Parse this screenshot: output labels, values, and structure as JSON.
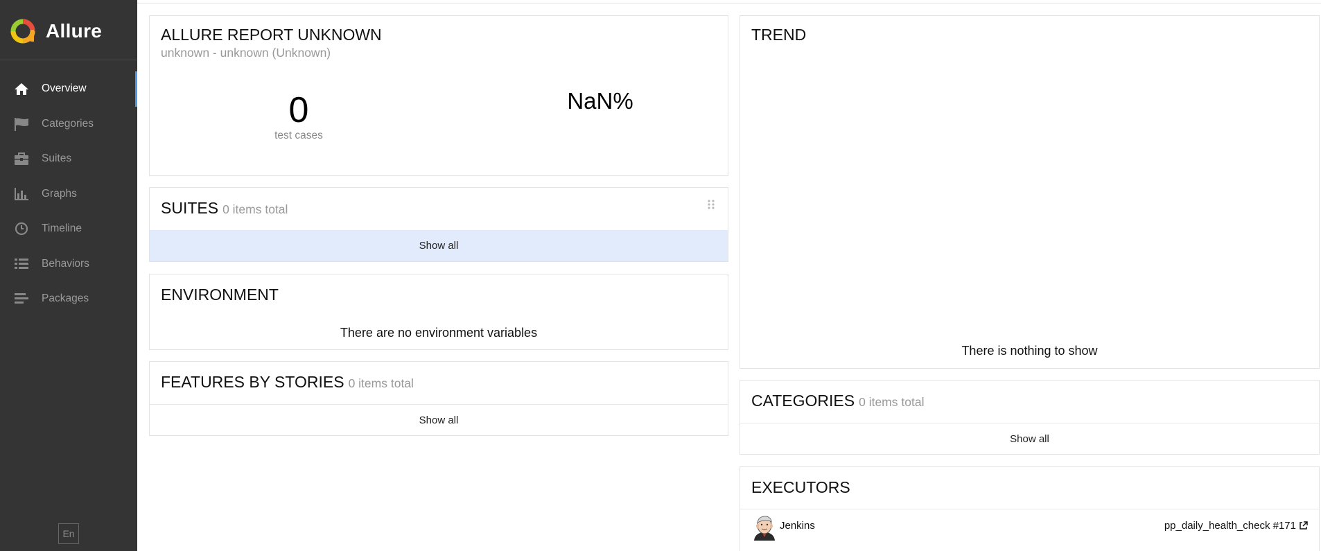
{
  "brand": {
    "name": "Allure"
  },
  "sidebar": {
    "items": [
      {
        "label": "Overview",
        "icon": "home-icon",
        "active": true
      },
      {
        "label": "Categories",
        "icon": "flag-icon",
        "active": false
      },
      {
        "label": "Suites",
        "icon": "briefcase-icon",
        "active": false
      },
      {
        "label": "Graphs",
        "icon": "bar-chart-icon",
        "active": false
      },
      {
        "label": "Timeline",
        "icon": "clock-icon",
        "active": false
      },
      {
        "label": "Behaviors",
        "icon": "list-icon",
        "active": false
      },
      {
        "label": "Packages",
        "icon": "align-left-icon",
        "active": false
      }
    ],
    "language": "En"
  },
  "summary": {
    "title": "ALLURE REPORT UNKNOWN",
    "subtitle": "unknown - unknown (Unknown)",
    "test_count": "0",
    "test_count_label": "test cases",
    "success_rate": "NaN%"
  },
  "suites": {
    "title": "SUITES",
    "count_label": "0 items total",
    "show_all": "Show all"
  },
  "environment": {
    "title": "ENVIRONMENT",
    "empty_message": "There are no environment variables"
  },
  "features": {
    "title": "FEATURES BY STORIES",
    "count_label": "0 items total",
    "show_all": "Show all"
  },
  "trend": {
    "title": "TREND",
    "empty_message": "There is nothing to show"
  },
  "categories": {
    "title": "CATEGORIES",
    "count_label": "0 items total",
    "show_all": "Show all"
  },
  "executors": {
    "title": "EXECUTORS",
    "items": [
      {
        "name": "Jenkins",
        "build": "pp_daily_health_check #171"
      }
    ]
  },
  "colors": {
    "sidebar_bg": "#343434",
    "active_indicator": "#4e9ae6",
    "highlight_row": "#e2ebfb"
  }
}
